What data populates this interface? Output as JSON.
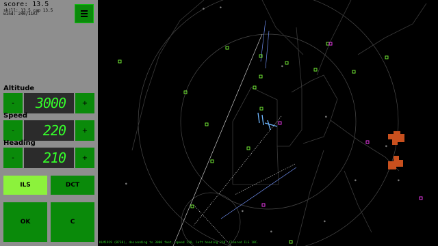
{
  "panel": {
    "score": "score: 13.5",
    "skill": "skill: 13.5 cap 13.5",
    "wind": "wind: 240/11KT",
    "menu_icon": "hamburger-menu-icon"
  },
  "altitude": {
    "label": "Altitude",
    "value": "3000",
    "minus": "-",
    "plus": "+"
  },
  "speed": {
    "label": "Speed",
    "value": "220",
    "minus": "-",
    "plus": "+"
  },
  "heading": {
    "label": "Heading",
    "value": "210",
    "minus": "-",
    "plus": "+"
  },
  "buttons": {
    "ils": "ILS",
    "dct": "DCT",
    "ok": "OK",
    "cancel": "C"
  },
  "colors": {
    "panel": "#8e8e8e",
    "button": "#0a8a0a",
    "button_active": "#8cf23c",
    "lcd_text": "#35ff2a",
    "aircraft": "#7cff3a",
    "selected": "#ff40ff",
    "weather": "#c8501e"
  },
  "status_line": "KLM1919 (B738), descending to 3000 feet, speed 220, left heading 210. Cleared ILS 18C."
}
